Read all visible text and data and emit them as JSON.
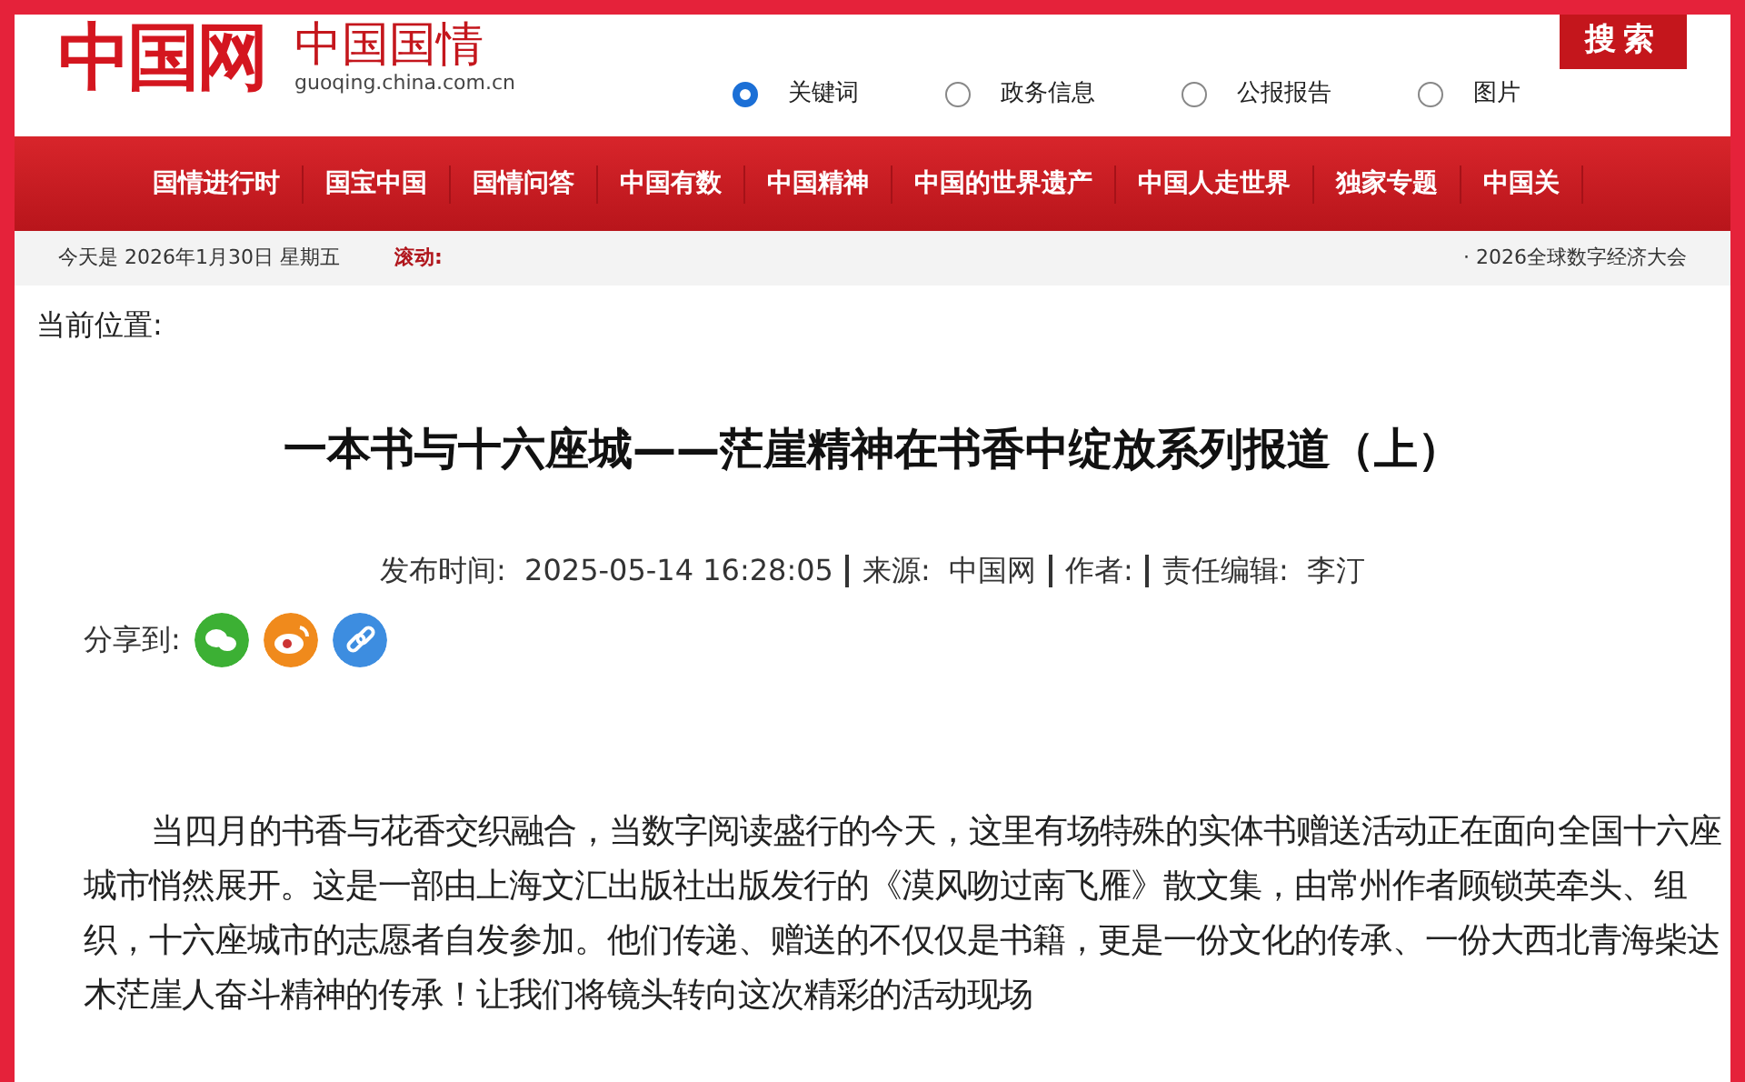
{
  "header": {
    "logo_mark": "中国网",
    "logo_name": "中国国情",
    "logo_domain": "guoqing.china.com.cn",
    "search_button": "搜索",
    "search_scopes": [
      {
        "label": "关键词",
        "selected": true
      },
      {
        "label": "政务信息",
        "selected": false
      },
      {
        "label": "公报报告",
        "selected": false
      },
      {
        "label": "图片",
        "selected": false
      }
    ]
  },
  "nav": [
    "国情进行时",
    "国宝中国",
    "国情问答",
    "中国有数",
    "中国精神",
    "中国的世界遗产",
    "中国人走世界",
    "独家专题",
    "中国关"
  ],
  "ticker": {
    "date": "今天是 2026年1月30日 星期五",
    "label": "滚动:",
    "item": "· 2026全球数字经济大会"
  },
  "breadcrumb": "当前位置:",
  "article": {
    "title": "一本书与十六座城——茫崖精神在书香中绽放系列报道（上）",
    "meta": [
      "发布时间:  2025-05-14 16:28:05",
      "来源:  中国网",
      "作者:",
      "责任编辑:  李汀"
    ],
    "share_label": "分享到:",
    "share": [
      {
        "kind": "wechat",
        "color": "#3cb034"
      },
      {
        "kind": "weibo",
        "color": "#f08a1c"
      },
      {
        "kind": "link",
        "color": "#3d8de0"
      }
    ],
    "paragraph": "当四月的书香与花香交织融合，当数字阅读盛行的今天，这里有场特殊的实体书赠送活动正在面向全国十六座城市悄然展开。这是一部由上海文汇出版社出版发行的《漠风吻过南飞雁》散文集，由常州作者顾锁英牵头、组织，十六座城市的志愿者自发参加。他们传递、赠送的不仅仅是书籍，更是一份文化的传承、一份大西北青海柴达木茫崖人奋斗精神的传承！让我们将镜头转向这次精彩的活动现场"
  }
}
